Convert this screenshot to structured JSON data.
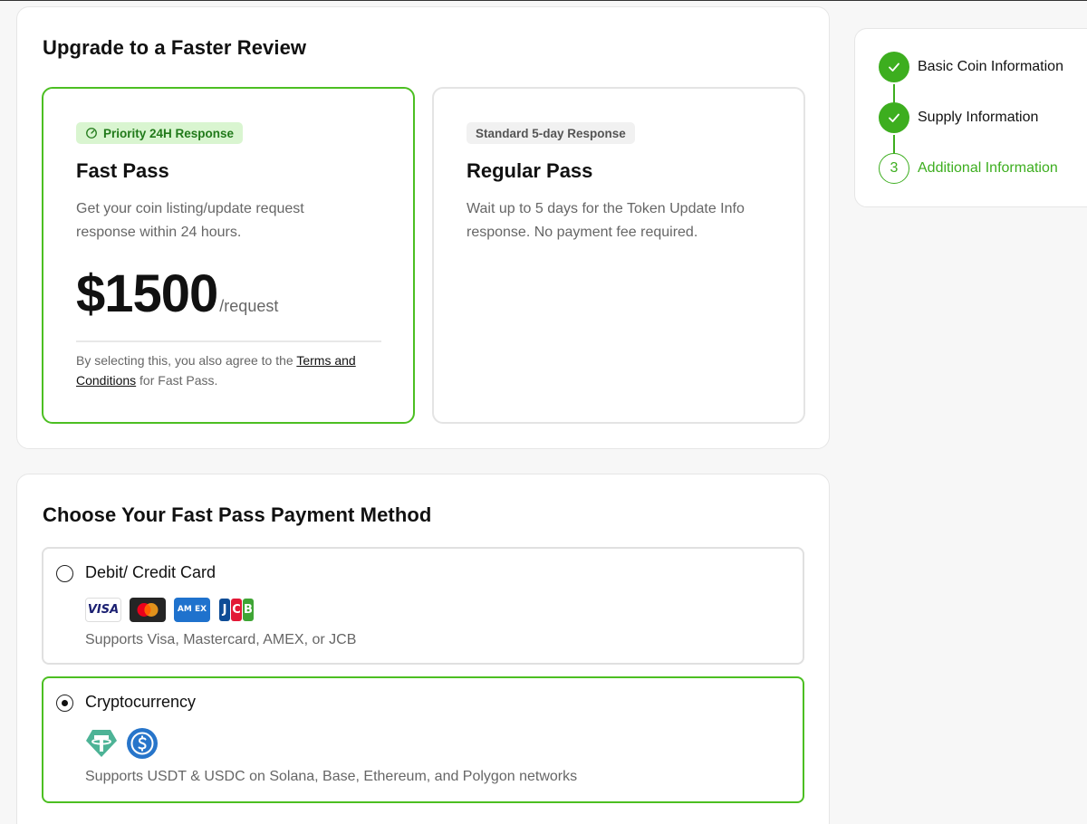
{
  "upgrade": {
    "title": "Upgrade to a Faster Review",
    "fast_pass": {
      "badge": "Priority 24H Response",
      "name": "Fast Pass",
      "description": "Get your coin listing/update request response within 24 hours.",
      "price": "$1500",
      "price_unit": "/request",
      "terms_prefix": "By selecting this, you also agree to the ",
      "terms_link": "Terms and Conditions",
      "terms_suffix": " for Fast Pass.",
      "selected": true
    },
    "regular_pass": {
      "badge": "Standard 5-day Response",
      "name": "Regular Pass",
      "description": "Wait up to 5 days for the Token Update Info response. No payment fee required.",
      "selected": false
    }
  },
  "payment": {
    "title": "Choose Your Fast Pass Payment Method",
    "methods": [
      {
        "label": "Debit/ Credit Card",
        "note": "Supports Visa, Mastercard, AMEX, or JCB",
        "logos": [
          "visa-logo",
          "mastercard-logo",
          "amex-logo",
          "jcb-logo"
        ],
        "logo_text": {
          "visa": "VISA",
          "amex": "AM EX",
          "jcb": [
            "J",
            "C",
            "B"
          ]
        },
        "selected": false
      },
      {
        "label": "Cryptocurrency",
        "note": "Supports USDT & USDC on Solana, Base, Ethereum, and Polygon networks",
        "logos": [
          "usdt-logo",
          "usdc-logo"
        ],
        "selected": true
      }
    ]
  },
  "steps": {
    "items": [
      {
        "label": "Basic Coin Information",
        "status": "done"
      },
      {
        "label": "Supply Information",
        "status": "done"
      },
      {
        "label": "Additional Information",
        "status": "current",
        "number": "3"
      }
    ]
  },
  "colors": {
    "accent": "#3dae1f",
    "selected_border": "#4cbf22",
    "badge_green_bg": "#d9f5d0",
    "usdt": "#4db396",
    "usdc": "#2775ca"
  }
}
